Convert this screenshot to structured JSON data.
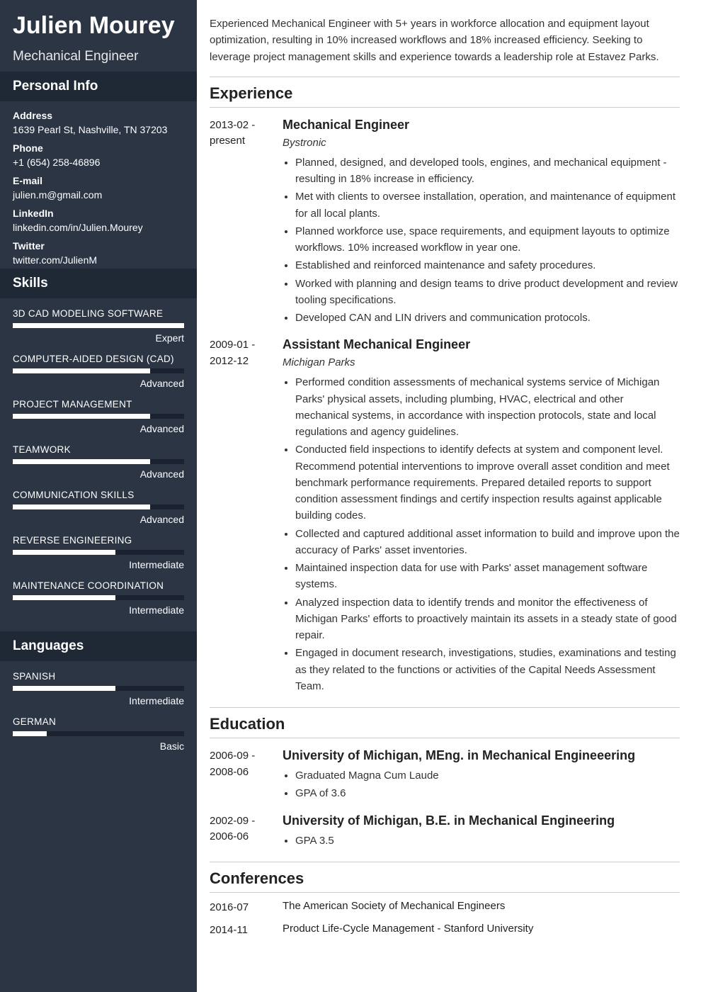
{
  "name": "Julien Mourey",
  "title": "Mechanical Engineer",
  "sidebar_headings": {
    "personal": "Personal Info",
    "skills": "Skills",
    "languages": "Languages"
  },
  "info": {
    "address_label": "Address",
    "address": "1639 Pearl St, Nashville, TN 37203",
    "phone_label": "Phone",
    "phone": "+1 (654) 258-46896",
    "email_label": "E-mail",
    "email": "julien.m@gmail.com",
    "linkedin_label": "LinkedIn",
    "linkedin": "linkedin.com/in/Julien.Mourey",
    "twitter_label": "Twitter",
    "twitter": "twitter.com/JulienM"
  },
  "skills": [
    {
      "name": "3D CAD MODELING SOFTWARE",
      "level": "Expert",
      "pct": 100
    },
    {
      "name": "COMPUTER-AIDED DESIGN (CAD)",
      "level": "Advanced",
      "pct": 80
    },
    {
      "name": "PROJECT MANAGEMENT",
      "level": "Advanced",
      "pct": 80
    },
    {
      "name": "TEAMWORK",
      "level": "Advanced",
      "pct": 80
    },
    {
      "name": "COMMUNICATION SKILLS",
      "level": "Advanced",
      "pct": 80
    },
    {
      "name": "REVERSE ENGINEERING",
      "level": "Intermediate",
      "pct": 60
    },
    {
      "name": "MAINTENANCE COORDINATION",
      "level": "Intermediate",
      "pct": 60
    }
  ],
  "languages": [
    {
      "name": "SPANISH",
      "level": "Intermediate",
      "pct": 60
    },
    {
      "name": "GERMAN",
      "level": "Basic",
      "pct": 20
    }
  ],
  "summary": "Experienced Mechanical Engineer with 5+ years in workforce allocation and equipment layout optimization, resulting in 10% increased workflows and 18% increased efficiency. Seeking to leverage project management skills and experience towards a leadership role at Estavez Parks.",
  "sections": {
    "experience": "Experience",
    "education": "Education",
    "conferences": "Conferences"
  },
  "experience": [
    {
      "dates": "2013-02 - present",
      "title": "Mechanical Engineer",
      "company": "Bystronic",
      "bullets": [
        "Planned, designed, and developed tools, engines, and mechanical equipment - resulting in 18% increase in efficiency.",
        "Met with clients to oversee installation, operation, and maintenance of equipment for all local plants.",
        "Planned workforce use, space requirements, and equipment layouts to optimize workflows. 10% increased workflow in year one.",
        "Established and reinforced maintenance and safety procedures.",
        "Worked with planning and design teams to drive product development and review tooling specifications.",
        "Developed CAN and LIN drivers and communication protocols."
      ]
    },
    {
      "dates": "2009-01 - 2012-12",
      "title": "Assistant Mechanical Engineer",
      "company": "Michigan Parks",
      "bullets": [
        "Performed condition assessments of mechanical systems service of Michigan Parks' physical assets, including plumbing, HVAC, electrical and other mechanical systems, in accordance with inspection protocols, state and local regulations and agency guidelines.",
        "Conducted field inspections to identify defects at system and component level. Recommend potential interventions to improve overall asset condition and meet benchmark performance requirements. Prepared detailed reports to support condition assessment findings and certify inspection results against applicable building codes.",
        "Collected and captured additional asset information to build and improve upon the accuracy of Parks' asset inventories.",
        "Maintained inspection data for use with Parks' asset management software systems.",
        "Analyzed inspection data to identify trends and monitor the effectiveness of Michigan Parks' efforts to proactively maintain its assets in a steady state of good repair.",
        "Engaged in document research, investigations, studies, examinations and testing as they related to the functions or activities of the Capital Needs Assessment Team."
      ]
    }
  ],
  "education": [
    {
      "dates": "2006-09 - 2008-06",
      "title": "University of Michigan, MEng. in Mechanical Engineeering",
      "bullets": [
        "Graduated Magna Cum Laude",
        "GPA of 3.6"
      ]
    },
    {
      "dates": "2002-09 - 2006-06",
      "title": "University of Michigan, B.E. in Mechanical Engineering",
      "bullets": [
        "GPA 3.5"
      ]
    }
  ],
  "conferences": [
    {
      "date": "2016-07",
      "name": "The American Society of Mechanical Engineers"
    },
    {
      "date": "2014-11",
      "name": "Product Life-Cycle Management - Stanford University"
    }
  ]
}
